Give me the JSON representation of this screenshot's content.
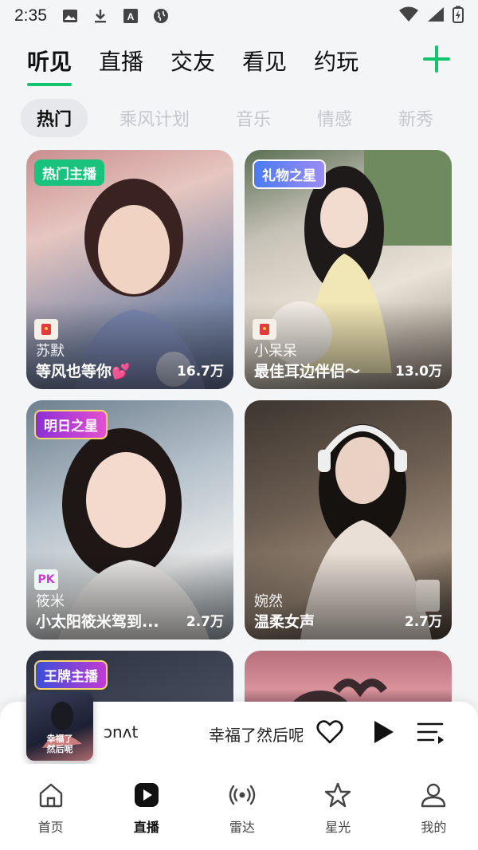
{
  "status": {
    "time": "2:35"
  },
  "top_tabs": [
    {
      "label": "听见",
      "active": true
    },
    {
      "label": "直播",
      "active": false
    },
    {
      "label": "交友",
      "active": false
    },
    {
      "label": "看见",
      "active": false
    },
    {
      "label": "约玩",
      "active": false
    }
  ],
  "chips": [
    {
      "label": "热门",
      "active": true
    },
    {
      "label": "乘风计划",
      "active": false
    },
    {
      "label": "音乐",
      "active": false
    },
    {
      "label": "情感",
      "active": false
    },
    {
      "label": "新秀",
      "active": false
    }
  ],
  "cards": [
    {
      "badge": "热门主播",
      "name": "苏默",
      "title": "等风也等你",
      "emoji": "💕",
      "count": "16.7万"
    },
    {
      "badge": "礼物之星",
      "name": "小呆呆",
      "title": "最佳耳边伴侣～",
      "count": "13.0万"
    },
    {
      "badge": "明日之星",
      "name": "筱米",
      "title": "小太阳筱米驾到...",
      "pk": "PK",
      "count": "2.7万"
    },
    {
      "name": "婉然",
      "title": "温柔女声",
      "count": "2.7万"
    },
    {
      "badge": "王牌主播"
    },
    {}
  ],
  "player": {
    "artist": "ɔnʌt",
    "song": "幸福了然后呢",
    "cover_text": "幸福了\n然后呢"
  },
  "nav": [
    {
      "label": "首页",
      "active": false
    },
    {
      "label": "直播",
      "active": true
    },
    {
      "label": "雷达",
      "active": false
    },
    {
      "label": "星光",
      "active": false
    },
    {
      "label": "我的",
      "active": false
    }
  ],
  "colors": {
    "accent": "#11c46e",
    "badge_hot": "#19c37d"
  }
}
